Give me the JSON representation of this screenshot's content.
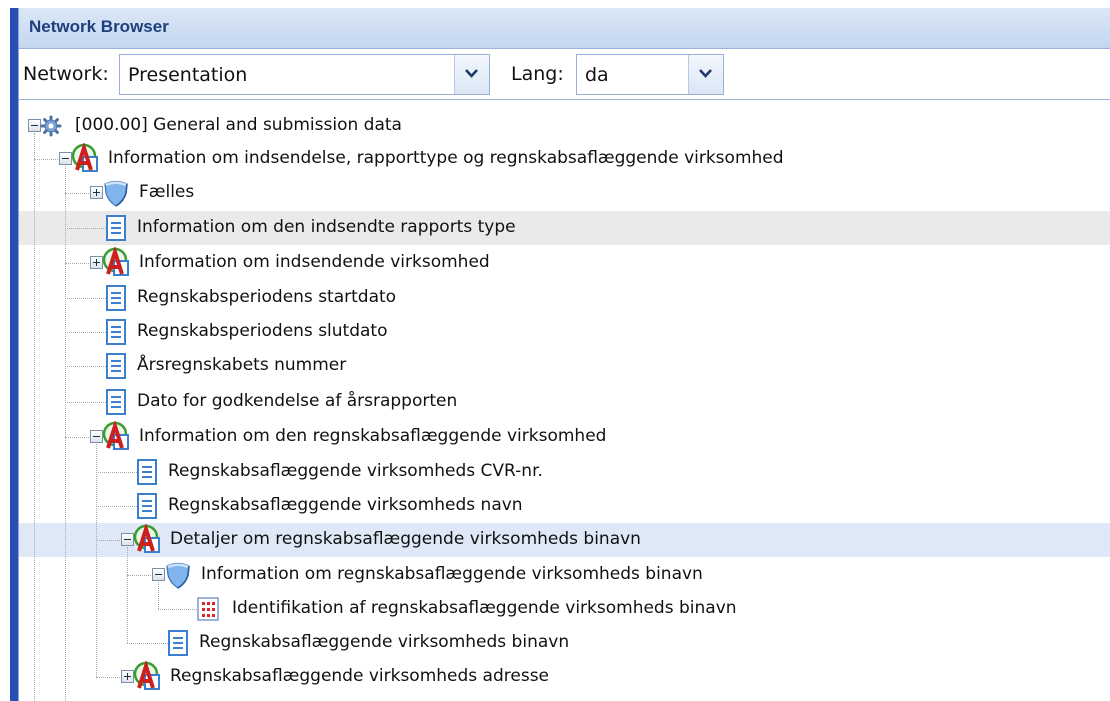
{
  "panel": {
    "title": "Network Browser"
  },
  "toolbar": {
    "network_label": "Network:",
    "network_value": "Presentation",
    "lang_label": "Lang:",
    "lang_value": "da"
  },
  "tree": {
    "nodes": [
      {
        "label": "[000.00] General and submission data",
        "icon": "gear-icon",
        "toggle": "minus"
      },
      {
        "label": "Information om indsendelse, rapporttype og regnskabsaflæggende virksomhed",
        "icon": "abstract-icon",
        "toggle": "minus"
      },
      {
        "label": "Fælles",
        "icon": "hypercube-icon",
        "toggle": "plus"
      },
      {
        "label": "Information om den indsendte rapports type",
        "icon": "document-icon",
        "toggle": "none",
        "selected": true
      },
      {
        "label": "Information om indsendende virksomhed",
        "icon": "abstract-icon",
        "toggle": "plus"
      },
      {
        "label": "Regnskabsperiodens startdato",
        "icon": "document-icon",
        "toggle": "none"
      },
      {
        "label": "Regnskabsperiodens slutdato",
        "icon": "document-icon",
        "toggle": "none"
      },
      {
        "label": "Årsregnskabets nummer",
        "icon": "document-icon",
        "toggle": "none"
      },
      {
        "label": "Dato for godkendelse af årsrapporten",
        "icon": "document-icon",
        "toggle": "none"
      },
      {
        "label": "Information om den regnskabsaflæggende virksomhed",
        "icon": "abstract-icon",
        "toggle": "minus"
      },
      {
        "label": "Regnskabsaflæggende virksomheds CVR-nr.",
        "icon": "document-icon",
        "toggle": "none"
      },
      {
        "label": "Regnskabsaflæggende virksomheds navn",
        "icon": "document-icon",
        "toggle": "none"
      },
      {
        "label": "Detaljer om regnskabsaflæggende virksomheds binavn",
        "icon": "abstract-icon",
        "toggle": "minus",
        "highlighted": true
      },
      {
        "label": "Information om regnskabsaflæggende virksomheds binavn",
        "icon": "hypercube-icon",
        "toggle": "minus"
      },
      {
        "label": "Identifikation af regnskabsaflæggende virksomheds binavn",
        "icon": "dimension-icon",
        "toggle": "none"
      },
      {
        "label": "Regnskabsaflæggende virksomheds binavn",
        "icon": "document-icon",
        "toggle": "none"
      },
      {
        "label": "Regnskabsaflæggende virksomheds adresse",
        "icon": "abstract-icon",
        "toggle": "plus"
      }
    ]
  },
  "colors": {
    "title_text": "#1d3f7b",
    "title_bar": "#c4d6ef",
    "left_border": "#2a4eb8",
    "selected_row": "#eaeaea",
    "highlighted_row": "#dfe8f6",
    "abstract_icon_red": "#cc1f1f",
    "abstract_icon_green": "#3a9b2f",
    "document_icon_blue": "#3b7fd0"
  }
}
